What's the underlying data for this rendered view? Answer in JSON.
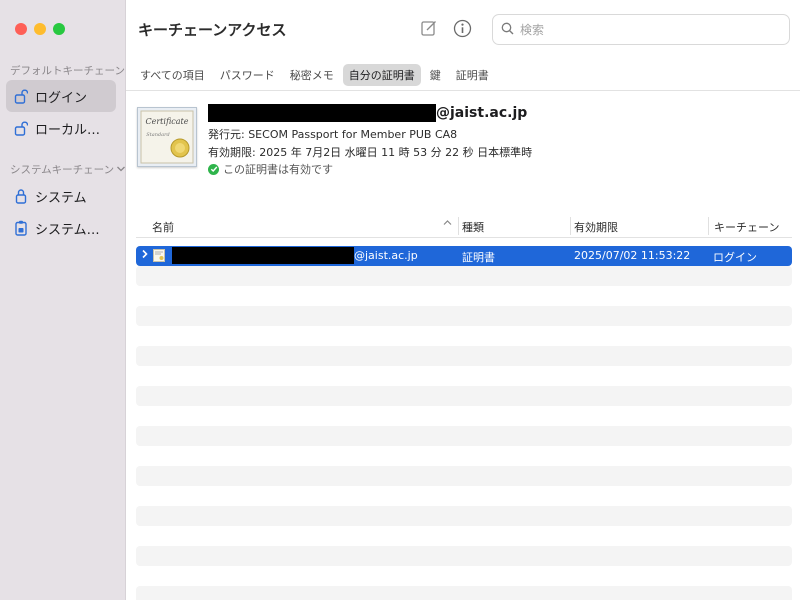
{
  "window": {
    "title": "キーチェーンアクセス"
  },
  "sidebar": {
    "default_section": "デフォルトキーチェーン",
    "default_items": [
      {
        "label": "ログイン"
      },
      {
        "label": "ローカル項目"
      }
    ],
    "system_section": "システムキーチェーン",
    "system_items": [
      {
        "label": "システム"
      },
      {
        "label": "システムル…"
      }
    ]
  },
  "search": {
    "placeholder": "検索",
    "value": ""
  },
  "tabs": [
    {
      "label": "すべての項目"
    },
    {
      "label": "パスワード"
    },
    {
      "label": "秘密メモ"
    },
    {
      "label": "自分の証明書"
    },
    {
      "label": "鍵"
    },
    {
      "label": "証明書"
    }
  ],
  "selected_tab": "自分の証明書",
  "certificate": {
    "name_domain": "@jaist.ac.jp",
    "issuer": "発行元: SECOM Passport for Member PUB CA8",
    "expiry": "有効期限: 2025 年 7月2日 水曜日 11 時 53 分 22 秒 日本標準時",
    "status": "この証明書は有効です"
  },
  "table": {
    "columns": [
      "名前",
      "種類",
      "有効期限",
      "キーチェーン"
    ],
    "rows": [
      {
        "name": "@jaist.ac.jp",
        "kind": "証明書",
        "expires": "2025/07/02 11:53:22",
        "keychain": "ログイン"
      }
    ]
  },
  "colors": {
    "selection": "#1f67d9",
    "sidebar_bg": "#e6e1e6",
    "accent_icon": "#2f6fd6",
    "valid_green": "#2fb44b"
  }
}
